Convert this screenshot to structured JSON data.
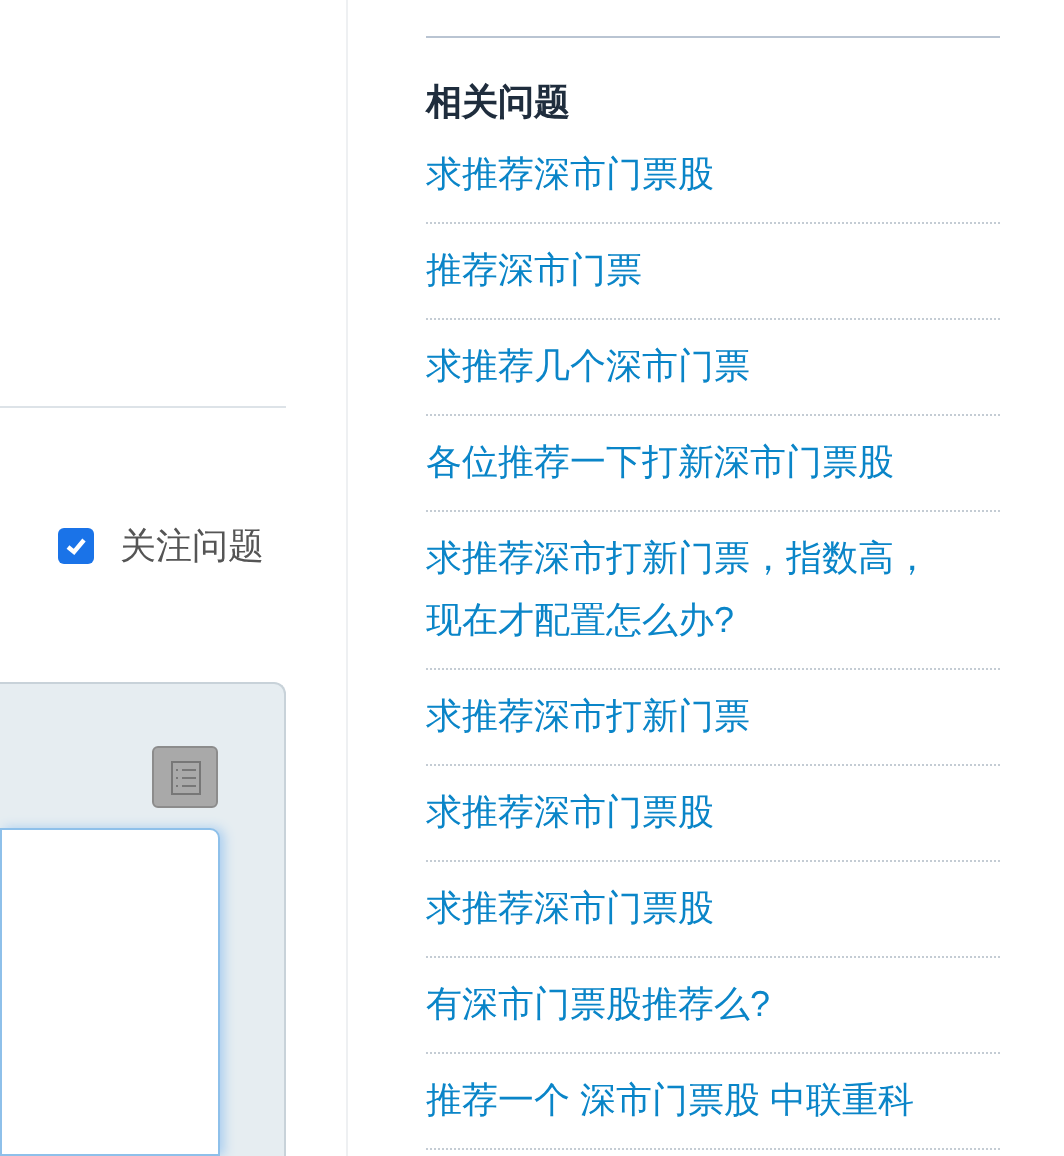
{
  "follow": {
    "label": "关注问题",
    "checked": true
  },
  "related": {
    "title": "相关问题",
    "items": [
      "求推荐深市门票股",
      "推荐深市门票",
      "求推荐几个深市门票",
      "各位推荐一下打新深市门票股",
      "求推荐深市打新门票，指数高，现在才配置怎么办?",
      "求推荐深市打新门票",
      "求推荐深市门票股",
      "求推荐深市门票股",
      "有深市门票股推荐么?",
      "推荐一个 深市门票股 中联重科"
    ]
  }
}
